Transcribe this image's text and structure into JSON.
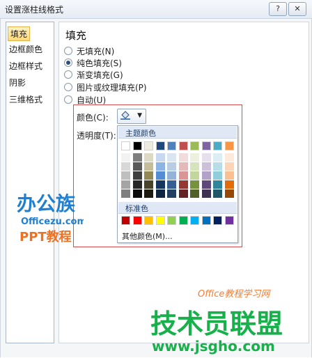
{
  "window": {
    "title": "设置涨柱线格式",
    "help_label": "?",
    "close_label": "✕"
  },
  "nav": {
    "items": [
      {
        "label": "填充",
        "selected": true
      },
      {
        "label": "边框颜色",
        "selected": false
      },
      {
        "label": "边框样式",
        "selected": false
      },
      {
        "label": "阴影",
        "selected": false
      },
      {
        "label": "三维格式",
        "selected": false
      }
    ]
  },
  "fill_panel": {
    "heading": "填充",
    "options": [
      {
        "label": "无填充(N)",
        "checked": false
      },
      {
        "label": "纯色填充(S)",
        "checked": true
      },
      {
        "label": "渐变填充(G)",
        "checked": false
      },
      {
        "label": "图片或纹理填充(P)",
        "checked": false
      },
      {
        "label": "自动(U)",
        "checked": false
      }
    ],
    "color_label": "颜色(C):",
    "transparency_label": "透明度(T):",
    "color_icon": "paint-bucket-icon"
  },
  "color_picker": {
    "theme_header": "主题颜色",
    "standard_header": "标准色",
    "other_label": "其他颜色(M)...",
    "theme_top": [
      "#ffffff",
      "#000000",
      "#eeece1",
      "#1f497d",
      "#4f81bd",
      "#c0504d",
      "#9bbb59",
      "#8064a2",
      "#4bacc6",
      "#f79646"
    ],
    "theme_shades": [
      [
        "#f2f2f2",
        "#d8d8d8",
        "#bfbfbf",
        "#a5a5a5",
        "#7f7f7f"
      ],
      [
        "#7f7f7f",
        "#595959",
        "#3f3f3f",
        "#262626",
        "#0d0d0d"
      ],
      [
        "#ddd9c3",
        "#c4bd97",
        "#938953",
        "#494429",
        "#1d1b10"
      ],
      [
        "#c6d9f0",
        "#8db3e2",
        "#548dd4",
        "#17365d",
        "#0f243e"
      ],
      [
        "#dbe5f1",
        "#b8cce4",
        "#95b3d7",
        "#366092",
        "#244061"
      ],
      [
        "#f2dcdb",
        "#e5b9b7",
        "#d99694",
        "#953734",
        "#632423"
      ],
      [
        "#ebf1dd",
        "#d7e3bc",
        "#c3d69b",
        "#76923c",
        "#4f6128"
      ],
      [
        "#e5e0ec",
        "#ccc1d9",
        "#b2a2c7",
        "#5f497a",
        "#3f3151"
      ],
      [
        "#dbeef3",
        "#b7dde8",
        "#92cddc",
        "#31859b",
        "#205867"
      ],
      [
        "#fdeada",
        "#fbd5b5",
        "#fac08f",
        "#e36c09",
        "#974806"
      ]
    ],
    "standard": [
      "#c00000",
      "#ff0000",
      "#ffc000",
      "#ffff00",
      "#92d050",
      "#00b050",
      "#00b0f0",
      "#0070c0",
      "#002060",
      "#7030a0"
    ]
  },
  "watermarks": {
    "left_logo": "办公族",
    "left_url": "Officezu.com",
    "left_tag": "PPT教程",
    "right_small": "Office教程学习网",
    "right_logo": "技术员联盟",
    "right_url": "www.jsgho.com"
  },
  "colors": {
    "accent_red_box": "#d64d4d",
    "nav_selected": "#ffd97a",
    "watermark_green": "#17b04a",
    "watermark_blue": "#1f7fd0",
    "watermark_orange": "#f07020"
  }
}
